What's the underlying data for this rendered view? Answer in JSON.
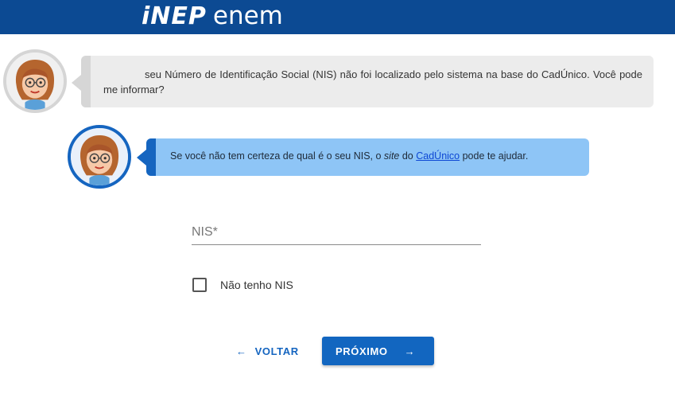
{
  "header": {
    "logo_inep": "iNEP",
    "logo_enem": "enem",
    "bg_color": "#0c4a93"
  },
  "messages": [
    {
      "text": "seu Número de Identificação Social (NIS) não foi localizado pelo sistema na base do CadÚnico. Você pode me informar?",
      "avatar_icon": "assistant-avatar-icon",
      "style": "gray"
    },
    {
      "text_before": "Se você não tem certeza de qual é o seu NIS, o ",
      "text_italic": "site",
      "text_middle": " do ",
      "link_label": "CadÚnico",
      "text_after": " pode te ajudar.",
      "avatar_icon": "assistant-avatar-icon",
      "style": "blue"
    }
  ],
  "form": {
    "nis_placeholder": "NIS*",
    "nis_value": "",
    "no_nis_label": "Não tenho NIS",
    "no_nis_checked": false
  },
  "actions": {
    "back_label": "VOLTAR",
    "back_icon": "arrow-left-icon",
    "next_label": "PRÓXIMO",
    "next_icon": "arrow-right-icon",
    "primary_color": "#1266c0"
  }
}
